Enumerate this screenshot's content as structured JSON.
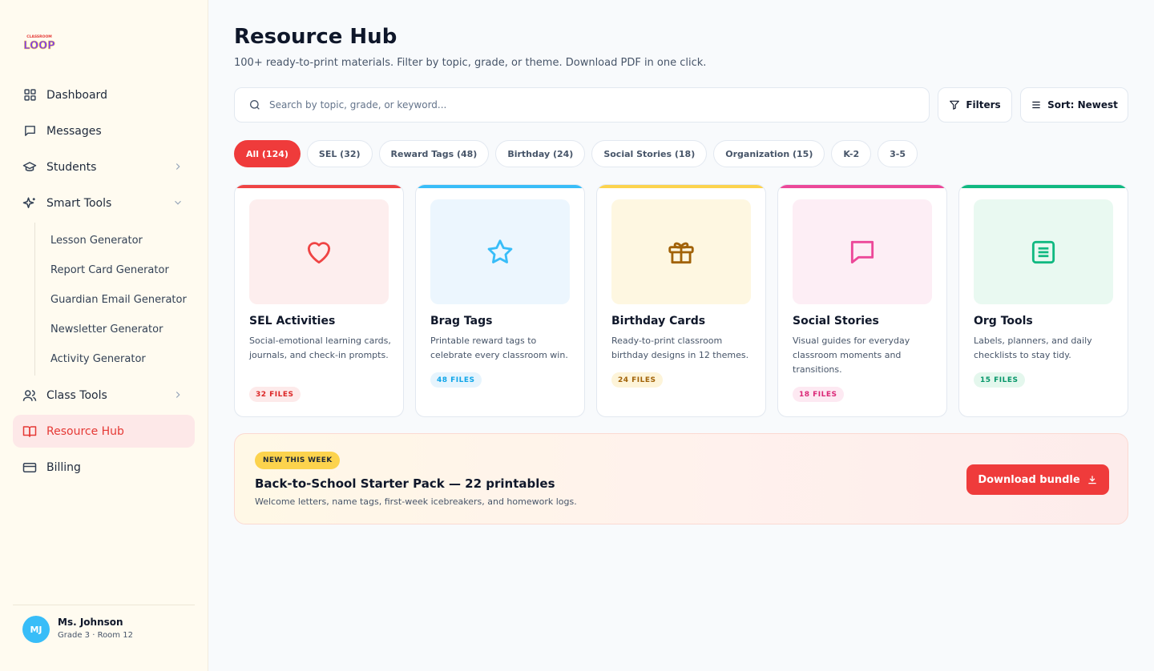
{
  "brand": {
    "name": "Classroom Loop",
    "logo_text": "LOOP",
    "logo_top": "CLASSROOM"
  },
  "sidebar": {
    "items": [
      {
        "label": "Dashboard",
        "icon": "grid-icon"
      },
      {
        "label": "Messages",
        "icon": "chat-icon"
      },
      {
        "label": "Students",
        "icon": "graduation-cap-icon",
        "chevron": "right"
      },
      {
        "label": "Smart Tools",
        "icon": "sparkles-icon",
        "chevron": "down"
      },
      {
        "label": "Class Tools",
        "icon": "users-icon",
        "chevron": "right"
      },
      {
        "label": "Resource Hub",
        "icon": "book-icon",
        "active": true
      },
      {
        "label": "Billing",
        "icon": "credit-card-icon"
      }
    ],
    "smart_tools_sub": [
      "Lesson Generator",
      "Report Card Generator",
      "Guardian Email Generator",
      "Newsletter Generator",
      "Activity Generator"
    ],
    "profile": {
      "initials": "MJ",
      "name": "Ms. Johnson",
      "detail": "Grade 3 · Room 12"
    }
  },
  "header": {
    "title": "Resource Hub",
    "subtitle": "100+ ready-to-print materials. Filter by topic, grade, or theme. Download PDF in one click."
  },
  "search": {
    "placeholder": "Search by topic, grade, or keyword...",
    "value": ""
  },
  "toolbar": {
    "filters_label": "Filters",
    "sort_label": "Sort: Newest"
  },
  "chips": [
    "All (124)",
    "SEL (32)",
    "Reward Tags (48)",
    "Birthday (24)",
    "Social Stories (18)",
    "Organization (15)",
    "K-2",
    "3-5"
  ],
  "active_chip": "All (124)",
  "cards": [
    {
      "title": "SEL Activities",
      "desc": "Social-emotional learning cards, journals, and check-in prompts.",
      "badge": "32 FILES",
      "icon": "heart-icon",
      "accent": "#ef4444",
      "bg": "#fdeeee",
      "badge_bg": "#fdeaea",
      "badge_fg": "#dc2626"
    },
    {
      "title": "Brag Tags",
      "desc": "Printable reward tags to celebrate every classroom win.",
      "badge": "48 FILES",
      "icon": "star-icon",
      "accent": "#38bdf8",
      "bg": "#ecf6fe",
      "badge_bg": "#e6f4fd",
      "badge_fg": "#0ea5e9"
    },
    {
      "title": "Birthday Cards",
      "desc": "Ready-to-print classroom birthday designs in 12 themes.",
      "badge": "24 FILES",
      "icon": "gift-icon",
      "accent": "#fcd34d",
      "bg": "#fef7e1",
      "badge_bg": "#fdf4d9",
      "badge_fg": "#a16207"
    },
    {
      "title": "Social Stories",
      "desc": "Visual guides for everyday classroom moments and transitions.",
      "badge": "18 FILES",
      "icon": "speech-bubble-icon",
      "accent": "#ec4899",
      "bg": "#fdeef5",
      "badge_bg": "#fde9f2",
      "badge_fg": "#db2777"
    },
    {
      "title": "Org Tools",
      "desc": "Labels, planners, and daily checklists to stay tidy.",
      "badge": "15 FILES",
      "icon": "list-icon",
      "accent": "#10b981",
      "bg": "#e9f9f1",
      "badge_bg": "#e4f7ed",
      "badge_fg": "#059669"
    }
  ],
  "promo": {
    "badge": "NEW THIS WEEK",
    "title": "Back-to-School Starter Pack — 22 printables",
    "subtitle": "Welcome letters, name tags, first-week icebreakers, and homework logs.",
    "button": "Download bundle"
  }
}
